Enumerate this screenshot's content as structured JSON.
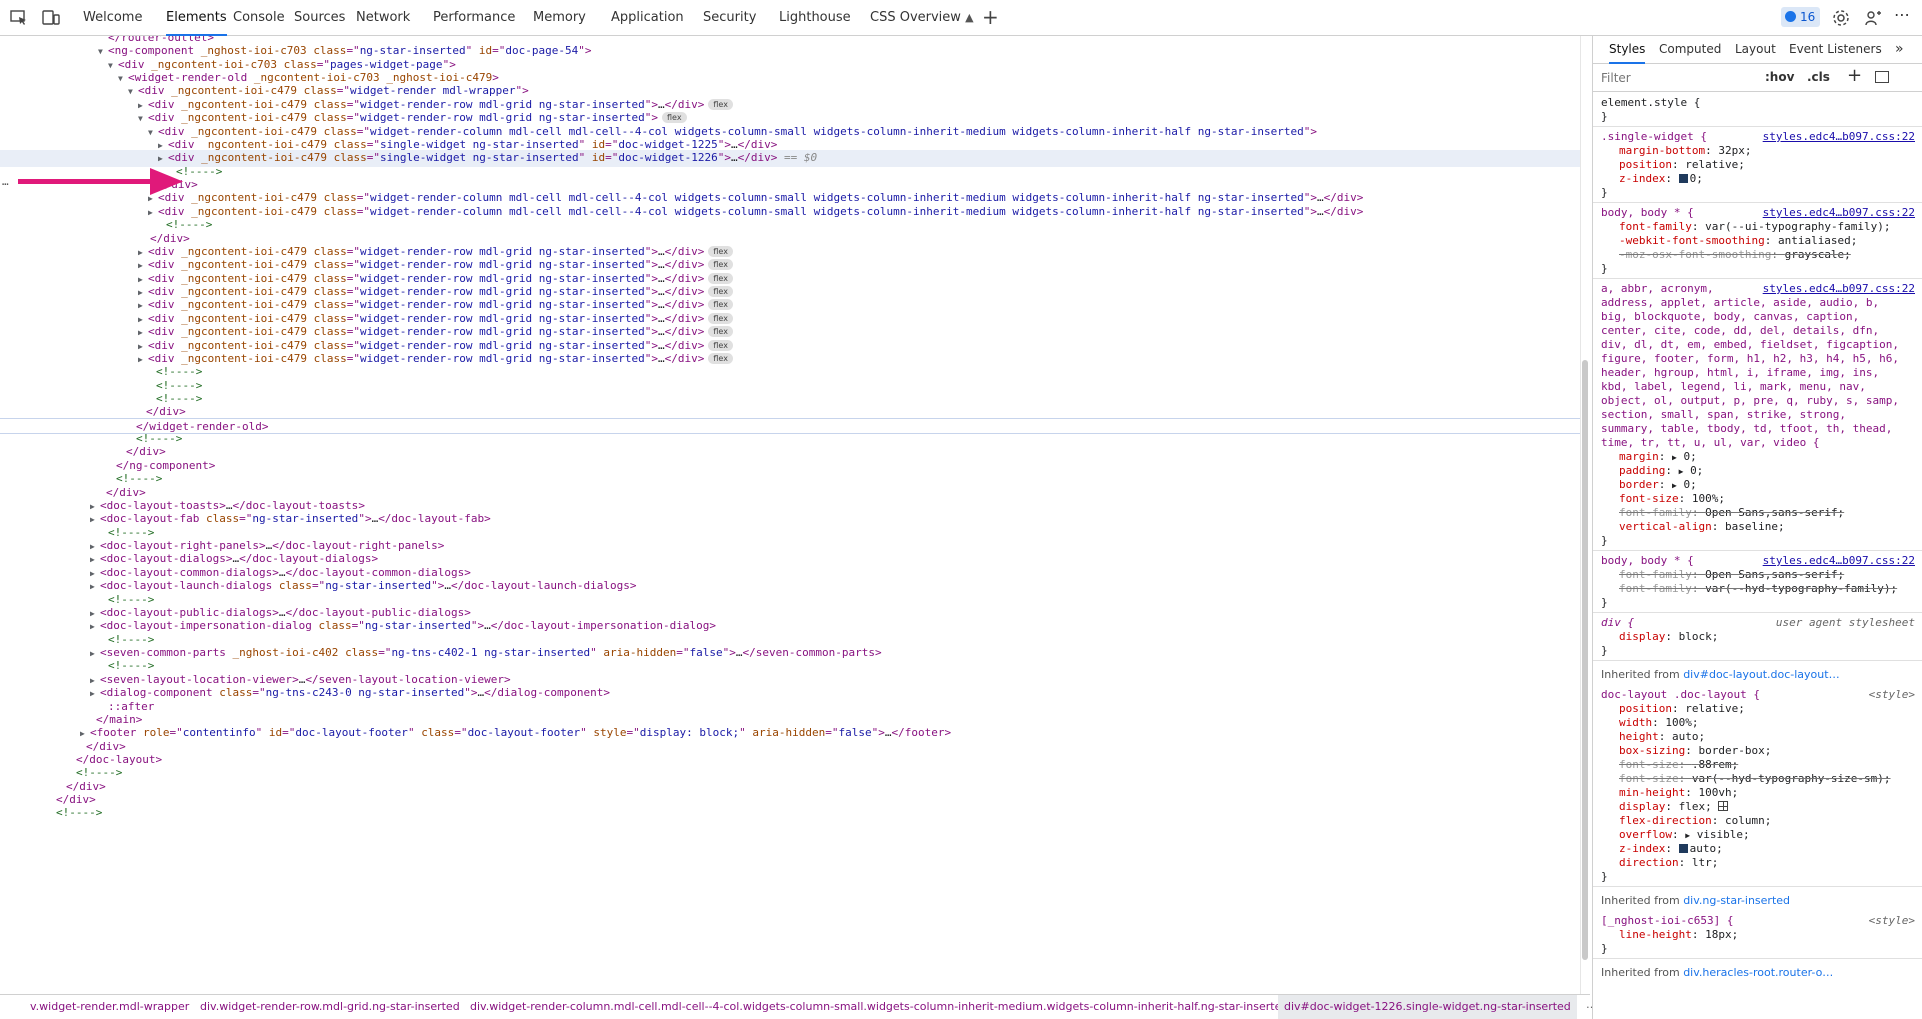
{
  "toolbar": {
    "tabs": [
      "Welcome",
      "Elements",
      "Console",
      "Sources",
      "Network",
      "Performance",
      "Memory",
      "Application",
      "Security",
      "Lighthouse",
      "CSS Overview"
    ],
    "active_tab": "Elements",
    "issues_count": "16"
  },
  "dom_lines": [
    "</router-outlet>",
    "<ng-component _nghost-ioi-c703 class=\"ng-star-inserted\" id=\"doc-page-54\">",
    "<div _ngcontent-ioi-c703 class=\"pages-widget-page\">",
    "<widget-render-old _ngcontent-ioi-c703 _nghost-ioi-c479>",
    "<div _ngcontent-ioi-c479 class=\"widget-render mdl-wrapper\">",
    "<div _ngcontent-ioi-c479 class=\"widget-render-row mdl-grid ng-star-inserted\">…</div>",
    "<div _ngcontent-ioi-c479 class=\"widget-render-row mdl-grid ng-star-inserted\">",
    "<div _ngcontent-ioi-c479 class=\"widget-render-column mdl-cell mdl-cell--4-col widgets-column-small widgets-column-inherit-medium widgets-column-inherit-half ng-star-inserted\">",
    "<div _ngcontent-ioi-c479 class=\"single-widget ng-star-inserted\" id=\"doc-widget-1225\">…</div>",
    "<div _ngcontent-ioi-c479 class=\"single-widget ng-star-inserted\" id=\"doc-widget-1226\">…</div>",
    "<!---->",
    "</div>",
    "<div _ngcontent-ioi-c479 class=\"widget-render-column mdl-cell mdl-cell--4-col widgets-column-small widgets-column-inherit-medium widgets-column-inherit-half ng-star-inserted\">…</div>",
    "<div _ngcontent-ioi-c479 class=\"widget-render-column mdl-cell mdl-cell--4-col widgets-column-small widgets-column-inherit-medium widgets-column-inherit-half ng-star-inserted\">…</div>",
    "<!---->",
    "</div>",
    "<div _ngcontent-ioi-c479 class=\"widget-render-row mdl-grid ng-star-inserted\">…</div>",
    "<div _ngcontent-ioi-c479 class=\"widget-render-row mdl-grid ng-star-inserted\">…</div>",
    "<div _ngcontent-ioi-c479 class=\"widget-render-row mdl-grid ng-star-inserted\">…</div>",
    "<div _ngcontent-ioi-c479 class=\"widget-render-row mdl-grid ng-star-inserted\">…</div>",
    "<div _ngcontent-ioi-c479 class=\"widget-render-row mdl-grid ng-star-inserted\">…</div>",
    "<div _ngcontent-ioi-c479 class=\"widget-render-row mdl-grid ng-star-inserted\">…</div>",
    "<div _ngcontent-ioi-c479 class=\"widget-render-row mdl-grid ng-star-inserted\">…</div>",
    "<div _ngcontent-ioi-c479 class=\"widget-render-row mdl-grid ng-star-inserted\">…</div>",
    "<div _ngcontent-ioi-c479 class=\"widget-render-row mdl-grid ng-star-inserted\">…</div>",
    "<!---->",
    "<!---->",
    "<!---->",
    "</div>",
    "</widget-render-old>",
    "<!---->",
    "</div>",
    "</ng-component>",
    "<!---->",
    "</div>",
    "<doc-layout-toasts>…</doc-layout-toasts>",
    "<doc-layout-fab class=\"ng-star-inserted\">…</doc-layout-fab>",
    "<!---->",
    "<doc-layout-right-panels>…</doc-layout-right-panels>",
    "<doc-layout-dialogs>…</doc-layout-dialogs>",
    "<doc-layout-common-dialogs>…</doc-layout-common-dialogs>",
    "<doc-layout-launch-dialogs class=\"ng-star-inserted\">…</doc-layout-launch-dialogs>",
    "<!---->",
    "<doc-layout-public-dialogs>…</doc-layout-public-dialogs>",
    "<doc-layout-impersonation-dialog class=\"ng-star-inserted\">…</doc-layout-impersonation-dialog>",
    "<!---->",
    "<seven-common-parts _nghost-ioi-c402 class=\"ng-tns-c402-1 ng-star-inserted\" aria-hidden=\"false\">…</seven-common-parts>",
    "<!---->",
    "<seven-layout-location-viewer>…</seven-layout-location-viewer>",
    "<dialog-component class=\"ng-tns-c243-0 ng-star-inserted\">…</dialog-component>",
    "::after",
    "</main>",
    "<footer role=\"contentinfo\" id=\"doc-layout-footer\" class=\"doc-layout-footer\" style=\"display: block;\" aria-hidden=\"false\">…</footer>",
    "</div>",
    "</doc-layout>",
    "<!---->",
    "</div>",
    "</div>",
    "<!---->"
  ],
  "flex_badge": "flex",
  "selected_suffix": "== $0",
  "breadcrumbs": [
    "v.widget-render.mdl-wrapper",
    "div.widget-render-row.mdl-grid.ng-star-inserted",
    "div.widget-render-column.mdl-cell.mdl-cell--4-col.widgets-column-small.widgets-column-inherit-medium.widgets-column-inherit-half.ng-star-inserted",
    "div#doc-widget-1226.single-widget.ng-star-inserted"
  ],
  "styles_tabs": [
    "Styles",
    "Computed",
    "Layout",
    "Event Listeners"
  ],
  "styles_active_tab": "Styles",
  "filter_placeholder": "Filter",
  "hov_label": ":hov",
  "cls_label": ".cls",
  "rules": {
    "element_style": "element.style {",
    "close": "}",
    "single_widget": {
      "selector": ".single-widget {",
      "source": "styles.edc4…b097.css:22",
      "props": [
        [
          "margin-bottom",
          "32px;"
        ],
        [
          "position",
          "relative;"
        ],
        [
          "z-index",
          "0;"
        ]
      ]
    },
    "body1": {
      "selector": "body, body * {",
      "source": "styles.edc4…b097.css:22",
      "props": [
        [
          "font-family",
          "var(--ui-typography-family);"
        ],
        [
          "-webkit-font-smoothing",
          "antialiased;"
        ],
        [
          "-moz-osx-font-smoothing",
          "grayscale;"
        ]
      ]
    },
    "reset": {
      "selector_lines": [
        "a, abbr, acronym,",
        "address, applet, article, aside, audio, b,",
        "big, blockquote, body, canvas, caption,",
        "center, cite, code, dd, del, details, dfn,",
        "div, dl, dt, em, embed, fieldset, figcaption,",
        "figure, footer, form, h1, h2, h3, h4, h5, h6,",
        "header, hgroup, html, i, iframe, img, ins,",
        "kbd, label, legend, li, mark, menu, nav,",
        "object, ol, output, p, pre, q, ruby, s, samp,",
        "section, small, span, strike, strong,",
        "summary, table, tbody, td, tfoot, th, thead,",
        "time, tr, tt, u, ul, var, video {"
      ],
      "source": "styles.edc4…b097.css:22",
      "props": [
        [
          "margin",
          "0;"
        ],
        [
          "padding",
          "0;"
        ],
        [
          "border",
          "0;"
        ],
        [
          "font-size",
          "100%;"
        ],
        [
          "font-family",
          "Open Sans,sans-serif;"
        ],
        [
          "vertical-align",
          "baseline;"
        ]
      ]
    },
    "body2": {
      "selector": "body, body * {",
      "source": "styles.edc4…b097.css:22",
      "props": [
        [
          "font-family",
          "Open Sans,sans-serif;"
        ],
        [
          "font-family",
          "var(--hyd-typography-family);"
        ]
      ]
    },
    "div_ua": {
      "selector": "div {",
      "source": "user agent stylesheet",
      "props": [
        [
          "display",
          "block;"
        ]
      ]
    },
    "inherited1": {
      "label": "Inherited from ",
      "link": "div#doc-layout.doc-layout…"
    },
    "doc_layout": {
      "selector": "doc-layout .doc-layout {",
      "source": "<style>",
      "props": [
        [
          "position",
          "relative;"
        ],
        [
          "width",
          "100%;"
        ],
        [
          "height",
          "auto;"
        ],
        [
          "box-sizing",
          "border-box;"
        ],
        [
          "font-size",
          ".88rem;"
        ],
        [
          "font-size",
          "var(--hyd-typography-size-sm);"
        ],
        [
          "min-height",
          "100vh;"
        ],
        [
          "display",
          "flex;"
        ],
        [
          "flex-direction",
          "column;"
        ],
        [
          "overflow",
          "visible;"
        ],
        [
          "z-index",
          "auto;"
        ],
        [
          "direction",
          "ltr;"
        ]
      ]
    },
    "inherited2": {
      "label": "Inherited from ",
      "link": "div.ng-star-inserted"
    },
    "nghost": {
      "selector": "[_nghost-ioi-c653] {",
      "source": "<style>",
      "props": [
        [
          "line-height",
          "18px;"
        ]
      ]
    },
    "inherited3": {
      "label": "Inherited from ",
      "link": "div.heracles-root.router-o…"
    }
  }
}
